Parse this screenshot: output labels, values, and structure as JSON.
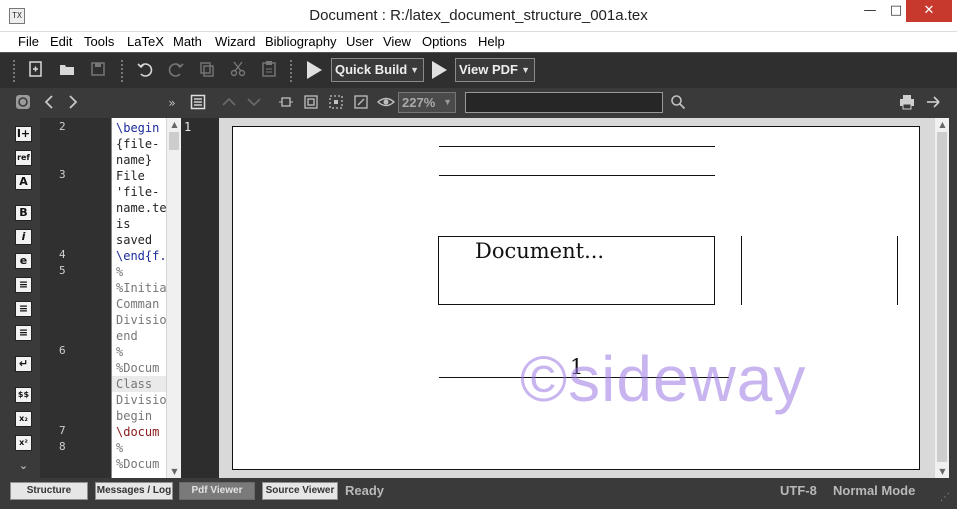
{
  "window": {
    "title": "Document : R:/latex_document_structure_001a.tex",
    "app_icon": "TX",
    "minimize": "—",
    "maximize": "□",
    "close": "✕"
  },
  "menu": [
    "File",
    "Edit",
    "Tools",
    "LaTeX",
    "Math",
    "Wizard",
    "Bibliography",
    "User",
    "View",
    "Options",
    "Help"
  ],
  "toolbar": {
    "quick_build_label": "Quick Build",
    "view_pdf_label": "View PDF",
    "icons": [
      "new-file-icon",
      "open-folder-icon",
      "save-icon",
      "undo-icon",
      "redo-icon",
      "copy-icon",
      "cut-icon",
      "paste-icon"
    ]
  },
  "pdf_toolbar": {
    "zoom": "227%",
    "search_value": ""
  },
  "left_strip": {
    "icons": [
      "insert-structure-icon",
      "ref-icon",
      "size-icon",
      "bold-icon",
      "italic-icon",
      "emphasis-icon",
      "align-left-icon",
      "align-center-icon",
      "align-right-icon",
      "newline-icon",
      "math-dollar-icon",
      "subscript-icon",
      "superscript-icon",
      "chevron-down-icon"
    ],
    "labels": [
      "I+",
      "ref",
      "A",
      "B",
      "i",
      "e",
      "≡",
      "≡",
      "≡",
      "↵",
      "$$",
      "x₂",
      "x²",
      "⌄"
    ]
  },
  "editor": {
    "line_numbers": [
      {
        "n": "2",
        "row": 0
      },
      {
        "n": "3",
        "row": 3
      },
      {
        "n": "4",
        "row": 8
      },
      {
        "n": "5",
        "row": 9
      },
      {
        "n": "6",
        "row": 14
      },
      {
        "n": "7",
        "row": 19
      },
      {
        "n": "8",
        "row": 20
      }
    ],
    "lines": [
      {
        "text": "\\begin",
        "cls": "kw"
      },
      {
        "text": "{file-",
        "cls": "tx"
      },
      {
        "text": "name}",
        "cls": "tx"
      },
      {
        "text": "File",
        "cls": "tx"
      },
      {
        "text": "'file-",
        "cls": "tx"
      },
      {
        "text": "name.te",
        "cls": "tx"
      },
      {
        "text": "is",
        "cls": "tx"
      },
      {
        "text": "saved",
        "cls": "tx"
      },
      {
        "text": "\\end{f.",
        "cls": "kw"
      },
      {
        "text": "%",
        "cls": "cm"
      },
      {
        "text": "%Initia",
        "cls": "cm"
      },
      {
        "text": "Comman",
        "cls": "cm"
      },
      {
        "text": "Divisio",
        "cls": "cm"
      },
      {
        "text": "end",
        "cls": "cm"
      },
      {
        "text": "%",
        "cls": "cm"
      },
      {
        "text": "%Docum",
        "cls": "cm"
      },
      {
        "text": "Class",
        "cls": "cm"
      },
      {
        "text": "Divisio",
        "cls": "cm"
      },
      {
        "text": "begin",
        "cls": "cm"
      },
      {
        "text": "\\docum",
        "cls": "kwr"
      },
      {
        "text": "%",
        "cls": "cm"
      },
      {
        "text": "%Docum",
        "cls": "cm"
      }
    ],
    "highlight_row": 16
  },
  "pdf": {
    "page_number_label": "1",
    "document_text": "Document...",
    "page_footer_number": "1",
    "watermark": "©sideway"
  },
  "statusbar": {
    "tabs": [
      "Structure",
      "Messages / Log",
      "Pdf Viewer",
      "Source Viewer"
    ],
    "active_tab": "Pdf Viewer",
    "status": "Ready",
    "encoding": "UTF-8",
    "mode": "Normal Mode"
  }
}
